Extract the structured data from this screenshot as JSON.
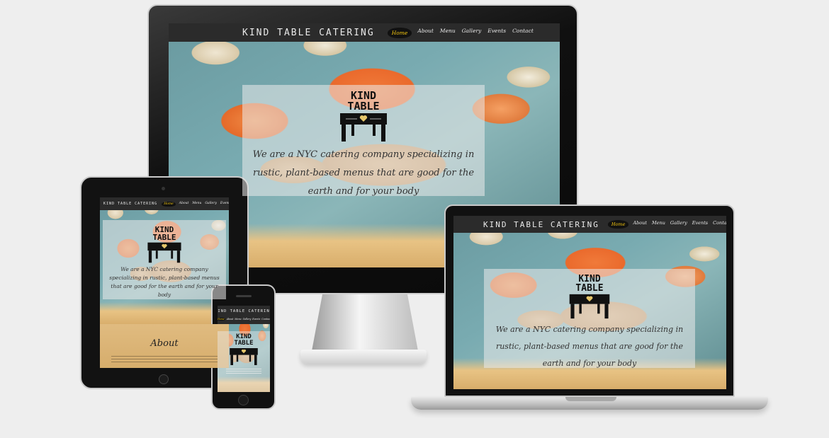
{
  "site": {
    "brand": "KIND TABLE CATERING",
    "nav": [
      "Home",
      "About",
      "Menu",
      "Gallery",
      "Events",
      "Contact"
    ],
    "logo_line1": "KIND",
    "logo_line2": "TABLE",
    "tagline": "We are a NYC catering company specializing in rustic, plant-based menus that are good for the earth and for your body",
    "about_heading": "About"
  },
  "colors": {
    "nav_bg": "#2b2b2b",
    "nav_active": "#f1c40f",
    "wood": "#e0bb80"
  },
  "icons": [
    "table-heart-icon"
  ]
}
